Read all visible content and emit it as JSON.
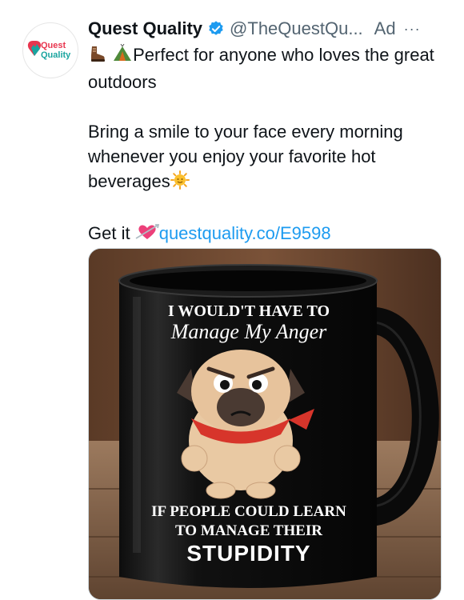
{
  "tweet": {
    "author_name": "Quest Quality",
    "author_handle": "@TheQuestQu...",
    "ad_label": "Ad",
    "more_label": "···",
    "avatar_logo_text": [
      "Quest",
      "Quality"
    ],
    "line1": "Perfect for anyone who loves the great outdoors",
    "line2": "Bring a smile to your face every morning whenever you enjoy your favorite hot beverages",
    "line3_prefix": "Get it",
    "link_text": "questquality.co/E9598",
    "icons": [
      "hiking-boot-icon",
      "camping-tent-icon",
      "sun-emoji-icon",
      "heart-arrow-icon",
      "verified-badge-icon"
    ]
  },
  "mug": {
    "line1": "I WOULD'T HAVE TO",
    "line2": "Manage My Anger",
    "line3": "IF PEOPLE COULD LEARN",
    "line4": "TO MANAGE THEIR",
    "line5": "STUPIDITY"
  },
  "colors": {
    "link": "#1d9bf0",
    "verified": "#1d9bf0",
    "secondary_text": "#536471"
  }
}
